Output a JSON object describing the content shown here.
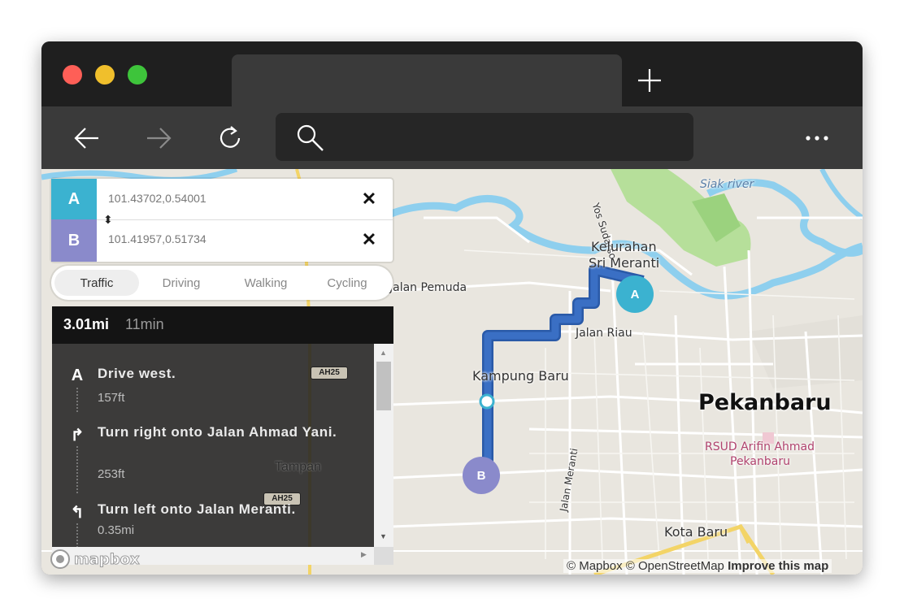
{
  "browser": {
    "new_tab_icon": "plus-icon",
    "back_icon": "arrow-left-icon",
    "forward_icon": "arrow-right-icon",
    "reload_icon": "reload-icon",
    "search_icon": "search-icon",
    "menu_icon": "more-icon"
  },
  "directions": {
    "origin": {
      "letter": "A",
      "value": "101.43702,0.54001",
      "color": "#3bb2d0"
    },
    "destination": {
      "letter": "B",
      "value": "101.41957,0.51734",
      "color": "#8a8acb"
    },
    "profiles": [
      "Traffic",
      "Driving",
      "Walking",
      "Cycling"
    ],
    "active_profile": "Traffic",
    "summary": {
      "distance": "3.01mi",
      "duration": "11min"
    },
    "steps": [
      {
        "icon": "A",
        "instruction": "Drive west.",
        "distance": "157ft"
      },
      {
        "icon": "↱",
        "instruction": "Turn right onto Jalan Ahmad Yani.",
        "distance": "253ft"
      },
      {
        "icon": "↰",
        "instruction": "Turn left onto Jalan Meranti.",
        "distance": "0.35mi"
      }
    ]
  },
  "map": {
    "labels": {
      "siak_river": "Siak river",
      "yos_sudarso": "Yos Sudarso",
      "kelurahan": "Kelurahan",
      "sri_meranti": "Sri Meranti",
      "jalan_pemuda": "Jalan Pemuda",
      "jalan_riau": "Jalan Riau",
      "kampung_baru": "Kampung Baru",
      "pekanbaru": "Pekanbaru",
      "rsud_1": "RSUD Arifin Ahmad",
      "rsud_2": "Pekanbaru",
      "tampan": "Tampan",
      "jalan_meranti": "Jalan Meranti",
      "kota_baru": "Kota Baru",
      "ah25_a": "AH25",
      "ah25_b": "AH25"
    },
    "markers": {
      "a": "A",
      "b": "B"
    },
    "route_color": "#3a6fc4",
    "attribution": {
      "mapbox": "© Mapbox",
      "osm": "© OpenStreetMap",
      "improve": "Improve this map"
    },
    "logo_text": "mapbox"
  }
}
